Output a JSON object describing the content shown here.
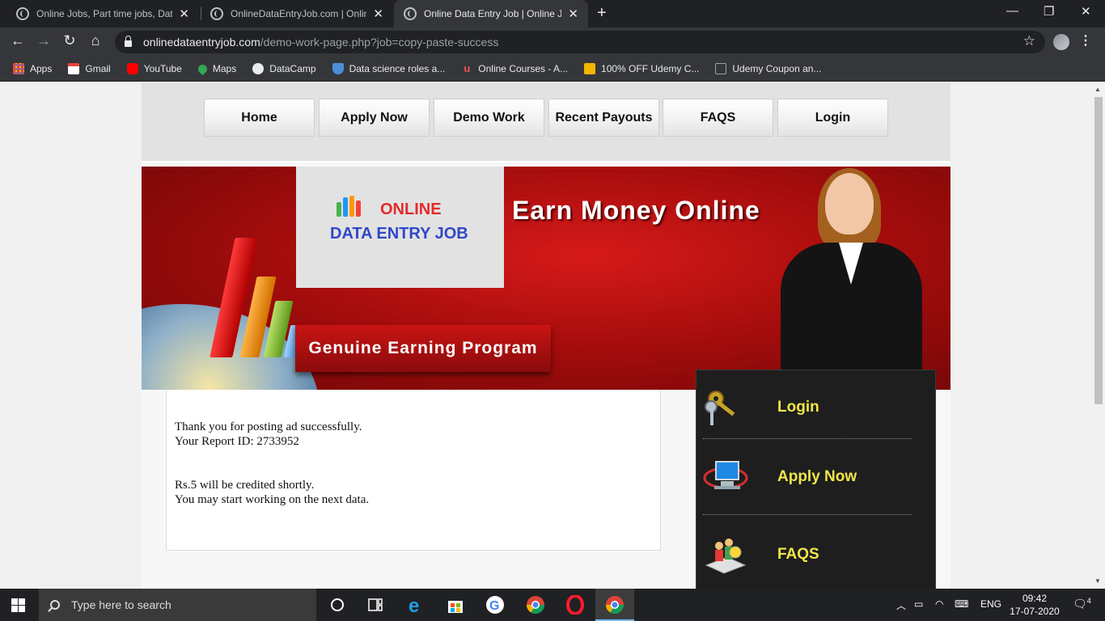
{
  "browser": {
    "tabs": [
      {
        "title": "Online Jobs, Part time jobs, Data",
        "active": false
      },
      {
        "title": "OnlineDataEntryJob.com | Online",
        "active": false
      },
      {
        "title": "Online Data Entry Job | Online Jo",
        "active": true
      }
    ],
    "new_tab_symbol": "+",
    "window_controls": {
      "minimize": "—",
      "restore": "❐",
      "close": "✕"
    },
    "url_host": "onlinedataentryjob.com",
    "url_path": "/demo-work-page.php?job=copy-paste-success",
    "bookmarks": [
      {
        "label": "Apps",
        "icon": "apps-grid-icon",
        "color": "#4285f4"
      },
      {
        "label": "Gmail",
        "icon": "gmail-icon",
        "color": "#ea4335"
      },
      {
        "label": "YouTube",
        "icon": "youtube-icon",
        "color": "#ff0000"
      },
      {
        "label": "Maps",
        "icon": "maps-pin-icon",
        "color": "#34a853"
      },
      {
        "label": "DataCamp",
        "icon": "globe-icon",
        "color": "#bdc1c6"
      },
      {
        "label": "Data science roles a...",
        "icon": "shield-icon",
        "color": "#4a90d9"
      },
      {
        "label": "Online Courses - A...",
        "icon": "udemy-icon",
        "color": "#ec5252"
      },
      {
        "label": "100% OFF Udemy C...",
        "icon": "tag-icon",
        "color": "#f4b400"
      },
      {
        "label": "Udemy Coupon an...",
        "icon": "rd-icon",
        "color": "#9aa0a6"
      }
    ]
  },
  "site": {
    "nav": [
      "Home",
      "Apply Now",
      "Demo Work",
      "Recent Payouts",
      "FAQS",
      "Login"
    ],
    "logo": {
      "line1": "ONLINE",
      "line2": "DATA ENTRY JOB"
    },
    "banner_headline": "Earn Money Online",
    "banner_tagline": "Genuine Earning Program",
    "message": {
      "line1": "Thank you for posting ad successfully.",
      "line2": "Your Report ID: 2733952",
      "line3": "Rs.5 will be credited shortly.",
      "line4": "You may start working on the next data."
    },
    "sidebar": [
      {
        "label": "Login",
        "icon": "keys-icon"
      },
      {
        "label": "Apply Now",
        "icon": "monitor-icon"
      },
      {
        "label": "FAQS",
        "icon": "people-icon"
      }
    ],
    "colors": {
      "banner_red": "#c40f0f",
      "sidebar_label": "#f1e54a",
      "logo_red": "#e32b2b",
      "logo_blue": "#3048c8"
    }
  },
  "taskbar": {
    "search_placeholder": "Type here to search",
    "language": "ENG",
    "time": "09:42",
    "date": "17-07-2020",
    "notification_count": "4"
  }
}
